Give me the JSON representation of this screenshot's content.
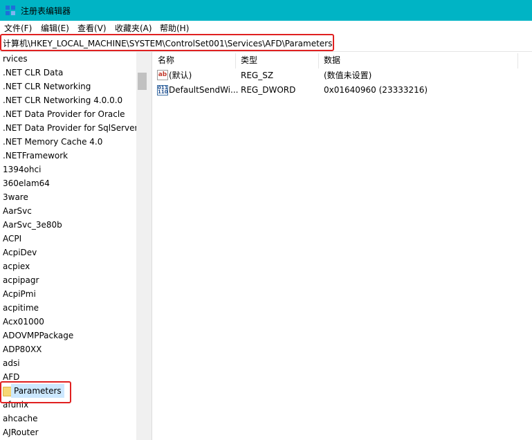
{
  "window": {
    "title": "注册表编辑器"
  },
  "menu": [
    "文件(F)",
    "编辑(E)",
    "查看(V)",
    "收藏夹(A)",
    "帮助(H)"
  ],
  "address": "计算机\\HKEY_LOCAL_MACHINE\\SYSTEM\\ControlSet001\\Services\\AFD\\Parameters",
  "tree": {
    "items": [
      "rvices",
      ".NET CLR Data",
      ".NET CLR Networking",
      ".NET CLR Networking 4.0.0.0",
      ".NET Data Provider for Oracle",
      ".NET Data Provider for SqlServer",
      ".NET Memory Cache 4.0",
      ".NETFramework",
      "1394ohci",
      "360elam64",
      "3ware",
      "AarSvc",
      "AarSvc_3e80b",
      "ACPI",
      "AcpiDev",
      "acpiex",
      "acpipagr",
      "AcpiPmi",
      "acpitime",
      "Acx01000",
      "ADOVMPPackage",
      "ADP80XX",
      "adsi",
      "AFD",
      "Parameters",
      "afunix",
      "ahcache",
      "AJRouter"
    ],
    "selected_index": 24
  },
  "columns": {
    "name": "名称",
    "type": "类型",
    "data": "数据"
  },
  "values": [
    {
      "name": "(默认)",
      "type": "REG_SZ",
      "data": "(数值未设置)",
      "icon": "string-value-icon"
    },
    {
      "name": "DefaultSendWi...",
      "type": "REG_DWORD",
      "data": "0x01640960 (23333216)",
      "icon": "binary-value-icon"
    }
  ],
  "colors": {
    "titlebar": "#00b4c5",
    "highlight": "#e02020",
    "selection": "#cce8ff"
  }
}
